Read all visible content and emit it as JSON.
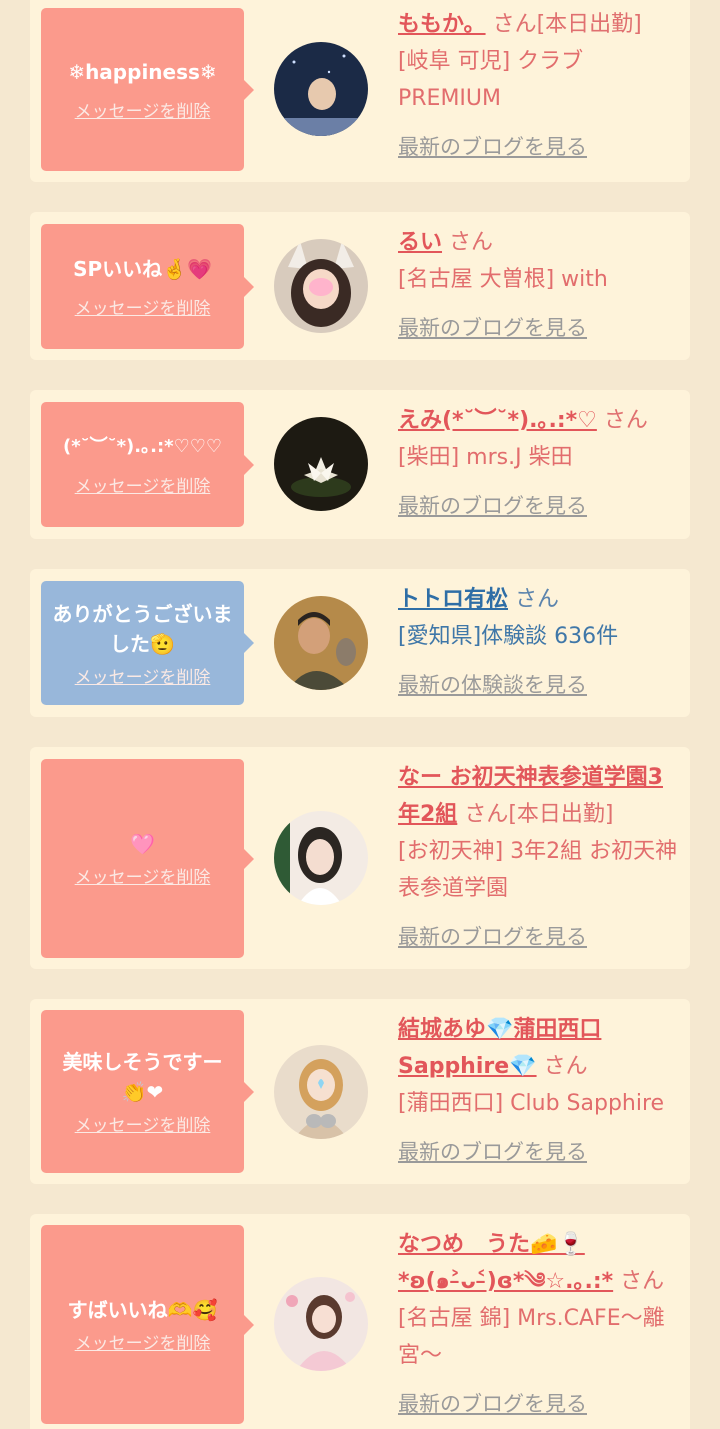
{
  "colors": {
    "background": "#f5e8d0",
    "card": "#fef3da",
    "bubble_pink": "#fb9a8c",
    "bubble_blue": "#98b7da",
    "name_pink": "#e2565a",
    "name_blue": "#2f6ea6",
    "link_gray": "#9a9a9a"
  },
  "delete_label": "メッセージを削除",
  "entries": [
    {
      "bubble_color": "pink",
      "message": "❄happiness❄",
      "name": "ももか。",
      "honorific": "さん[本日出勤]",
      "shop": "[岐阜 可児] クラブPREMIUM",
      "link": "最新のブログを見る"
    },
    {
      "bubble_color": "pink",
      "message": "SPいいね🤞💗",
      "name": "るい",
      "honorific": "さん",
      "shop": "[名古屋 大曽根] with",
      "link": "最新のブログを見る"
    },
    {
      "bubble_color": "pink",
      "message": "(*˘︶˘*).｡.:*♡♡♡",
      "name": "えみ(*˘︶˘*).｡.:*♡",
      "honorific": "さん",
      "shop": "[柴田] mrs.J 柴田",
      "link": "最新のブログを見る"
    },
    {
      "bubble_color": "blue",
      "message": "ありがとうございました🫡",
      "name": "トトロ有松",
      "honorific": "さん",
      "shop": "[愛知県]体験談 636件",
      "link": "最新の体験談を見る"
    },
    {
      "bubble_color": "pink",
      "message": "🩷",
      "name": "なー お初天神表参道学園3年2組",
      "honorific": "さん[本日出勤]",
      "shop": "[お初天神] 3年2組 お初天神表参道学園",
      "link": "最新のブログを見る"
    },
    {
      "bubble_color": "pink",
      "message": "美味しそうですー👏❤",
      "name": "結城あゆ💎蒲田西口Sapphire💎",
      "honorific": "さん",
      "shop": "[蒲田西口] Club Sapphire",
      "link": "最新のブログを見る"
    },
    {
      "bubble_color": "pink",
      "message": "すばいいね🫶🥰",
      "name": "なつめ　うた🧀🍷*ʚ(๑˃̵ᴗ˂̵)ɞ*༄☆.｡.:*",
      "honorific": "さん",
      "shop": "[名古屋 錦] Mrs.CAFE〜離宮〜",
      "link": "最新のブログを見る"
    }
  ]
}
